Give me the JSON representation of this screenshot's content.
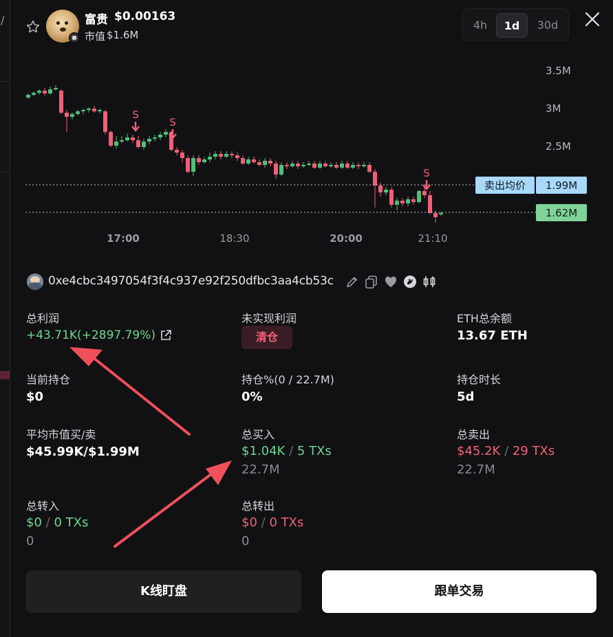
{
  "underlay": {
    "slash": "/"
  },
  "header": {
    "token_name": "富贵",
    "price": "$0.00163",
    "mcap_label": "市值",
    "mcap_value": "$1.6M",
    "timeframes": [
      "4h",
      "1d",
      "30d"
    ],
    "active_timeframe": "1d"
  },
  "chart": {
    "y_ticks": [
      "3.5M",
      "3M",
      "2.5M"
    ],
    "x_ticks": [
      "17:00",
      "18:30",
      "20:00",
      "21:10"
    ],
    "sell_marker": "S",
    "avg_sell_label": "卖出均价",
    "avg_sell_value": "1.99M",
    "current_value": "1.62M"
  },
  "chart_data": {
    "type": "candlestick",
    "title": "",
    "xlabel": "",
    "ylabel": "",
    "y_ticks": [
      3500000,
      3000000,
      2500000
    ],
    "x_ticks": [
      "17:00",
      "18:30",
      "20:00",
      "21:10"
    ],
    "reference_lines": [
      {
        "label": "卖出均价",
        "value": 1990000
      },
      {
        "label": "",
        "value": 1620000
      }
    ],
    "sell_markers": 3,
    "colors": {
      "up": "#4fbf7a",
      "down": "#ef5f7a"
    }
  },
  "wallet": {
    "address": "0xe4cbc3497054f3f4c937e92f250dfbc3aa4cb53c"
  },
  "stats": {
    "total_profit_label": "总利润",
    "total_profit_value": "+43.71K(+2897.79%)",
    "unrealized_label": "未实现利润",
    "clear_label": "清仓",
    "eth_label": "ETH总余额",
    "eth_value": "13.67 ETH",
    "holding_label": "当前持仓",
    "holding_value": "$0",
    "holding_pct_label": "持仓%(0 / 22.7M)",
    "holding_pct_value": "0%",
    "duration_label": "持仓时长",
    "duration_value": "5d",
    "avg_mcap_label": "平均市值买/卖",
    "avg_mcap_value": "$45.99K/$1.99M",
    "total_buy_label": "总买入",
    "total_buy_amount": "$1.04K",
    "total_buy_txs": "5 TXs",
    "total_buy_tokens": "22.7M",
    "total_sell_label": "总卖出",
    "total_sell_amount": "$45.2K",
    "total_sell_txs": "29 TXs",
    "total_sell_tokens": "22.7M",
    "transfer_in_label": "总转入",
    "transfer_in_amount": "$0",
    "transfer_in_txs": "0 TXs",
    "transfer_in_tokens": "0",
    "transfer_out_label": "总转出",
    "transfer_out_amount": "$0",
    "transfer_out_txs": "0 TXs",
    "transfer_out_tokens": "0",
    "separator": "/"
  },
  "buttons": {
    "kline": "K线盯盘",
    "copy_trade": "跟单交易"
  }
}
